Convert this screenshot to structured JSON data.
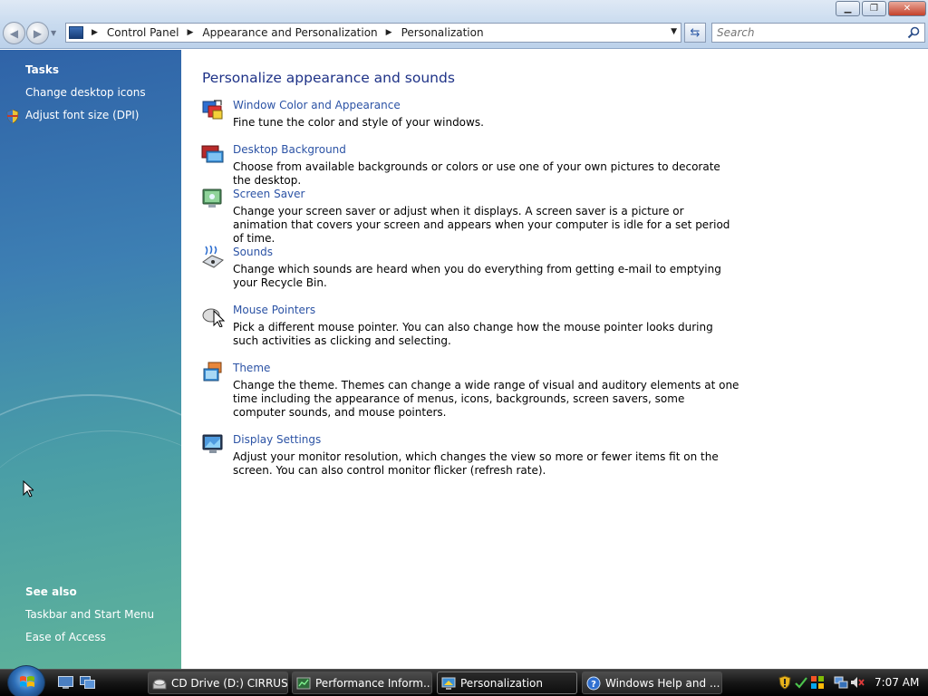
{
  "window": {
    "minimize_glyph": "▁",
    "maximize_glyph": "❐",
    "close_glyph": "✕"
  },
  "address_bar": {
    "breadcrumbs": [
      "Control Panel",
      "Appearance and Personalization",
      "Personalization"
    ],
    "search_placeholder": "Search"
  },
  "left_pane": {
    "tasks_heading": "Tasks",
    "tasks": [
      "Change desktop icons",
      "Adjust font size (DPI)"
    ],
    "see_also_heading": "See also",
    "see_also": [
      "Taskbar and Start Menu",
      "Ease of Access"
    ]
  },
  "main": {
    "title": "Personalize appearance and sounds",
    "items": [
      {
        "title": "Window Color and Appearance",
        "icon": "window-color-icon",
        "description": "Fine tune the color and style of your windows."
      },
      {
        "title": "Desktop Background",
        "icon": "desktop-background-icon",
        "description": "Choose from available backgrounds or colors or use one of your own pictures to decorate the desktop."
      },
      {
        "title": "Screen Saver",
        "icon": "screen-saver-icon",
        "description": "Change your screen saver or adjust when it displays. A screen saver is a picture or animation that covers your screen and appears when your computer is idle for a set period of time."
      },
      {
        "title": "Sounds",
        "icon": "sounds-icon",
        "description": "Change which sounds are heard when you do everything from getting e-mail to emptying your Recycle Bin."
      },
      {
        "title": "Mouse Pointers",
        "icon": "mouse-pointers-icon",
        "description": "Pick a different mouse pointer. You can also change how the mouse pointer looks during such activities as clicking and selecting."
      },
      {
        "title": "Theme",
        "icon": "theme-icon",
        "description": "Change the theme. Themes can change a wide range of visual and auditory elements at one time including the appearance of menus, icons, backgrounds, screen savers, some computer sounds, and mouse pointers."
      },
      {
        "title": "Display Settings",
        "icon": "display-settings-icon",
        "description": "Adjust your monitor resolution, which changes the view so more or fewer items fit on the screen. You can also control monitor flicker (refresh rate)."
      }
    ]
  },
  "taskbar": {
    "buttons": [
      {
        "label": "CD Drive (D:) CIRRUS",
        "icon": "cd-drive-icon",
        "active": false
      },
      {
        "label": "Performance Inform...",
        "icon": "performance-icon",
        "active": false
      },
      {
        "label": "Personalization",
        "icon": "personalization-icon",
        "active": true
      },
      {
        "label": "Windows Help and ...",
        "icon": "help-icon",
        "active": false
      }
    ],
    "clock": "7:07 AM"
  },
  "colors": {
    "link": "#2c53a5",
    "title": "#1e3287",
    "left_pane_top": "#2f63a8",
    "left_pane_bottom": "#5fb39a"
  }
}
